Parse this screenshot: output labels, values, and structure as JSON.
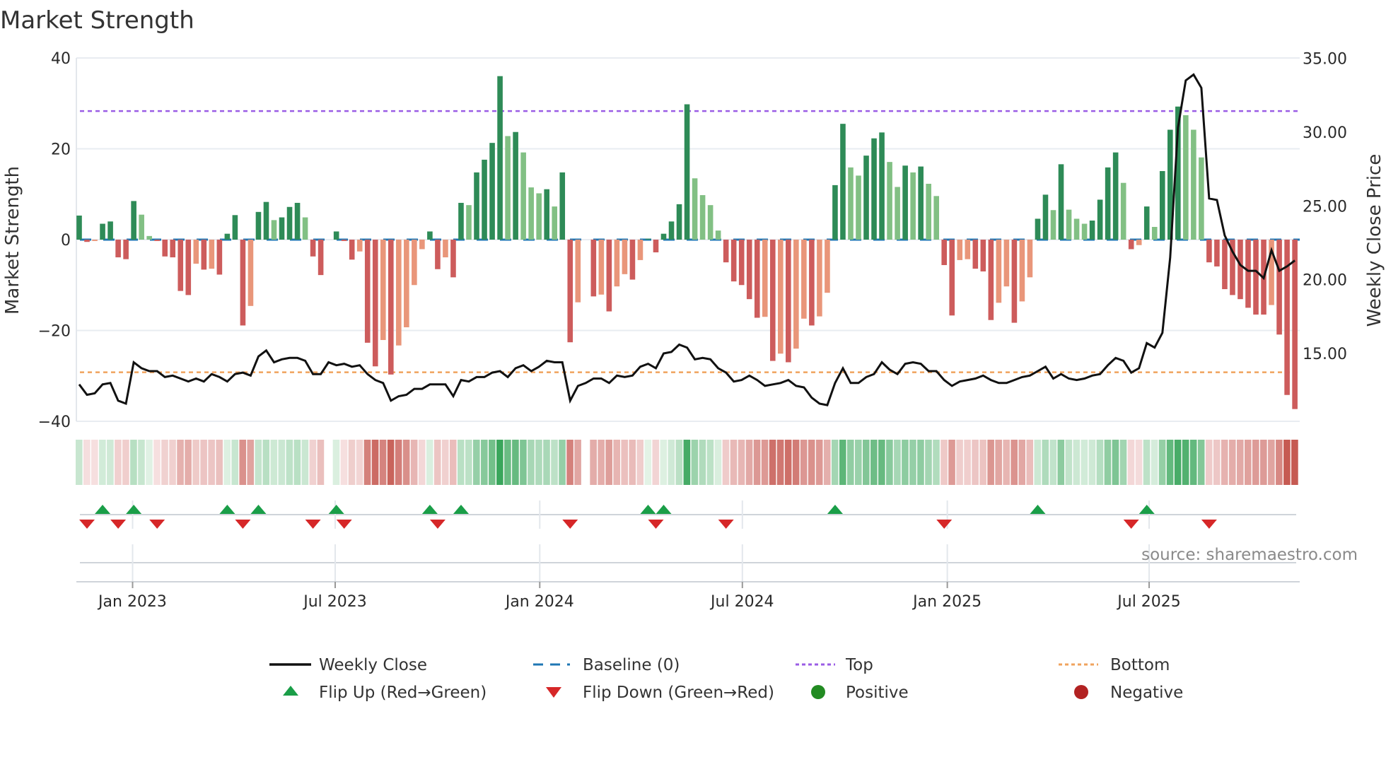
{
  "title": "Market Strength",
  "source": "source: sharemaestro.com",
  "colors": {
    "strong_pos": "#2e8b57",
    "weak_pos": "#82c084",
    "strong_neg": "#cd5c5c",
    "weak_neg": "#e9967a",
    "close": "#111111",
    "baseline": "#1f77b4",
    "top": "#9b5de5",
    "bottom": "#f0a35e",
    "flip_up": "#1a9e48",
    "flip_down": "#d62728",
    "positive": "#228b22",
    "negative": "#b22222"
  },
  "legend": [
    {
      "label": "Weekly Close",
      "icon": "solid-line"
    },
    {
      "label": "Baseline (0)",
      "icon": "dashed-line"
    },
    {
      "label": "Top",
      "icon": "dotted-line-purple"
    },
    {
      "label": "Bottom",
      "icon": "dotted-line-orange"
    },
    {
      "label": "Flip Up (Red→Green)",
      "icon": "triangle-up"
    },
    {
      "label": "Flip Down (Green→Red)",
      "icon": "triangle-down"
    },
    {
      "label": "Positive",
      "icon": "circle-green"
    },
    {
      "label": "Negative",
      "icon": "circle-red"
    }
  ],
  "chart_data": {
    "type": "bar",
    "title": "Market Strength",
    "ylabel": "Market Strength",
    "y2label": "Weekly Close Price",
    "ylim": [
      -40,
      40
    ],
    "y2lim": [
      15,
      35
    ],
    "yticks": [
      "40",
      "20",
      "0",
      "−20",
      "−40"
    ],
    "ytick_values": [
      40,
      20,
      0,
      -20,
      -40
    ],
    "y2ticks": [
      "35.00",
      "30.00",
      "25.00",
      "20.00",
      "15.00"
    ],
    "y2tick_values": [
      35,
      30,
      25,
      20,
      15
    ],
    "xticks": [
      {
        "label": "Jan 2023",
        "week": 7.85
      },
      {
        "label": "Jul 2023",
        "week": 33.85
      },
      {
        "label": "Jan 2024",
        "week": 60.1
      },
      {
        "label": "Jul 2024",
        "week": 86.1
      },
      {
        "label": "Jan 2025",
        "week": 112.4
      },
      {
        "label": "Jul 2025",
        "week": 138.3
      }
    ],
    "top_level": 28.3,
    "bottom_level": -29.2,
    "baseline": 0,
    "strength": [
      5.3,
      -0.5,
      -0.3,
      3.5,
      4,
      -3.9,
      -4.3,
      8.5,
      5.5,
      0.8,
      -0.3,
      -3.7,
      -3.9,
      -11.3,
      -12.2,
      -5.3,
      -6.6,
      -6.4,
      -7.7,
      1.3,
      5.4,
      -18.9,
      -14.6,
      6.1,
      8.3,
      4.3,
      4.9,
      7.2,
      8.1,
      4.9,
      -3.7,
      -7.8,
      0,
      1.8,
      -0.3,
      -4.4,
      -2.6,
      -22.7,
      -27.9,
      -22.1,
      -29.7,
      -23.3,
      -19.3,
      -10,
      -2.1,
      1.8,
      -6.5,
      -3.9,
      -8.3,
      8.1,
      7.6,
      14.8,
      17.6,
      21.3,
      36,
      22.8,
      23.7,
      19.2,
      11.5,
      10.2,
      11.1,
      7.3,
      14.8,
      -22.6,
      -13.8,
      0,
      -12.5,
      -12.1,
      -15.8,
      -10.3,
      -7.6,
      -8.8,
      -4.5,
      0.2,
      -2.8,
      1.3,
      4,
      7.8,
      29.8,
      13.5,
      9.8,
      7.6,
      2,
      -5,
      -9.2,
      -10,
      -13.1,
      -17.2,
      -17,
      -26.7,
      -25.1,
      -27,
      -24,
      -17.4,
      -18.9,
      -16.9,
      -11.7,
      12,
      25.5,
      15.9,
      14.1,
      18.5,
      22.3,
      23.6,
      17.1,
      11.6,
      16.3,
      14.8,
      16.1,
      12.3,
      9.6,
      -5.6,
      -16.7,
      -4.5,
      -4.3,
      -6.4,
      -7,
      -17.7,
      -13.9,
      -10.3,
      -18.3,
      -13.6,
      -8.3,
      4.6,
      9.9,
      6.5,
      16.6,
      6.6,
      4.6,
      3.5,
      4.2,
      8.8,
      15.9,
      19.2,
      12.5,
      -2.1,
      -1.2,
      7.3,
      2.8,
      15.1,
      24.2,
      29.3,
      27.4,
      24.2,
      18.1,
      -5,
      -5.9,
      -10.9,
      -12.2,
      -13.1,
      -15,
      -16.5,
      -16.5,
      -14.4,
      -20.9,
      -34.2,
      -37.3
    ],
    "weekly_close": [
      12.9,
      12.2,
      12.3,
      12.9,
      13.0,
      11.8,
      11.6,
      14.4,
      14.0,
      13.8,
      13.8,
      13.4,
      13.5,
      13.3,
      13.1,
      13.3,
      13.1,
      13.6,
      13.4,
      13.1,
      13.6,
      13.7,
      13.5,
      14.8,
      15.2,
      14.4,
      14.6,
      14.7,
      14.7,
      14.5,
      13.6,
      13.6,
      14.4,
      14.2,
      14.3,
      14.1,
      14.2,
      13.6,
      13.2,
      13.0,
      11.8,
      12.1,
      12.2,
      12.6,
      12.6,
      12.9,
      12.9,
      12.9,
      12.1,
      13.2,
      13.1,
      13.4,
      13.4,
      13.7,
      13.8,
      13.4,
      14.0,
      14.2,
      13.8,
      14.1,
      14.5,
      14.4,
      14.4,
      11.8,
      12.8,
      13.0,
      13.3,
      13.3,
      13.0,
      13.5,
      13.4,
      13.5,
      14.1,
      14.3,
      14.0,
      15.0,
      15.1,
      15.6,
      15.4,
      14.6,
      14.7,
      14.6,
      14.0,
      13.7,
      13.1,
      13.2,
      13.5,
      13.2,
      12.8,
      12.9,
      13.0,
      13.2,
      12.8,
      12.7,
      12.0,
      11.6,
      11.5,
      13.0,
      14.0,
      13.0,
      13.0,
      13.4,
      13.6,
      14.4,
      13.9,
      13.6,
      14.3,
      14.4,
      14.3,
      13.8,
      13.8,
      13.2,
      12.8,
      13.1,
      13.2,
      13.3,
      13.5,
      13.2,
      13.0,
      13.0,
      13.2,
      13.4,
      13.5,
      13.8,
      14.1,
      13.3,
      13.6,
      13.3,
      13.2,
      13.3,
      13.5,
      13.6,
      14.2,
      14.7,
      14.5,
      13.7,
      14.0,
      15.7,
      15.4,
      16.4,
      21.5,
      30.3,
      33.5,
      33.9,
      33.0,
      25.5,
      25.4,
      23.0,
      21.9,
      21.0,
      20.6,
      20.6,
      20.1,
      22.0,
      20.6,
      20.9,
      21.3
    ],
    "flip_up_weeks": [
      4,
      8,
      20,
      24,
      34,
      46,
      50,
      74,
      76,
      98,
      124,
      138
    ],
    "flip_down_weeks": [
      2,
      6,
      11,
      22,
      31,
      35,
      47,
      64,
      75,
      84,
      112,
      136,
      146
    ]
  }
}
